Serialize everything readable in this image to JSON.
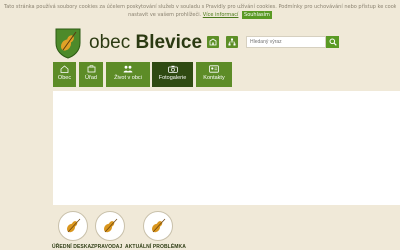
{
  "cookie_bar": {
    "text_line1": "Tato stránka používá soubory cookies za účelem poskytování služeb v souladu s Pravidly pro užívání cookies. Podmínky pro uchovávání nebo přístup ke cookies lze",
    "text_line2": "nastavit ve vašem prohlížeči.",
    "more_info_link": "Více informací",
    "accept_button": "Souhlasím"
  },
  "header": {
    "title_prefix": "obec",
    "title_name": "Blevice",
    "buttons": [
      {
        "icon": "building-icon"
      },
      {
        "icon": "sitemap-icon"
      }
    ],
    "search": {
      "placeholder": "Hledaný výraz",
      "button_icon": "search-icon"
    }
  },
  "nav": {
    "items": [
      {
        "label": "Obec",
        "icon": "home-icon",
        "active": false
      },
      {
        "label": "Úřad",
        "icon": "office-icon",
        "active": false
      },
      {
        "label": "Život v obci",
        "icon": "people-icon",
        "active": false
      },
      {
        "label": "Fotogalerie",
        "icon": "camera-icon",
        "active": true
      },
      {
        "label": "Kontakty",
        "icon": "contacts-icon",
        "active": false
      }
    ]
  },
  "quick_links": [
    {
      "label": "ÚŘEDNÍ DESKA",
      "icon": "violin-icon"
    },
    {
      "label": "ZPRAVODAJ",
      "icon": "violin-icon"
    },
    {
      "label": "AKTUÁLNÍ PROBLÉMKA",
      "icon": "violin-icon"
    }
  ],
  "colors": {
    "accent": "#5a9a24",
    "nav": "#5d8c27",
    "nav_active": "#2f4a12",
    "page_background": "#f0e9d8",
    "crest_shield": "#4d8a2a",
    "violin": "#d9961e"
  }
}
